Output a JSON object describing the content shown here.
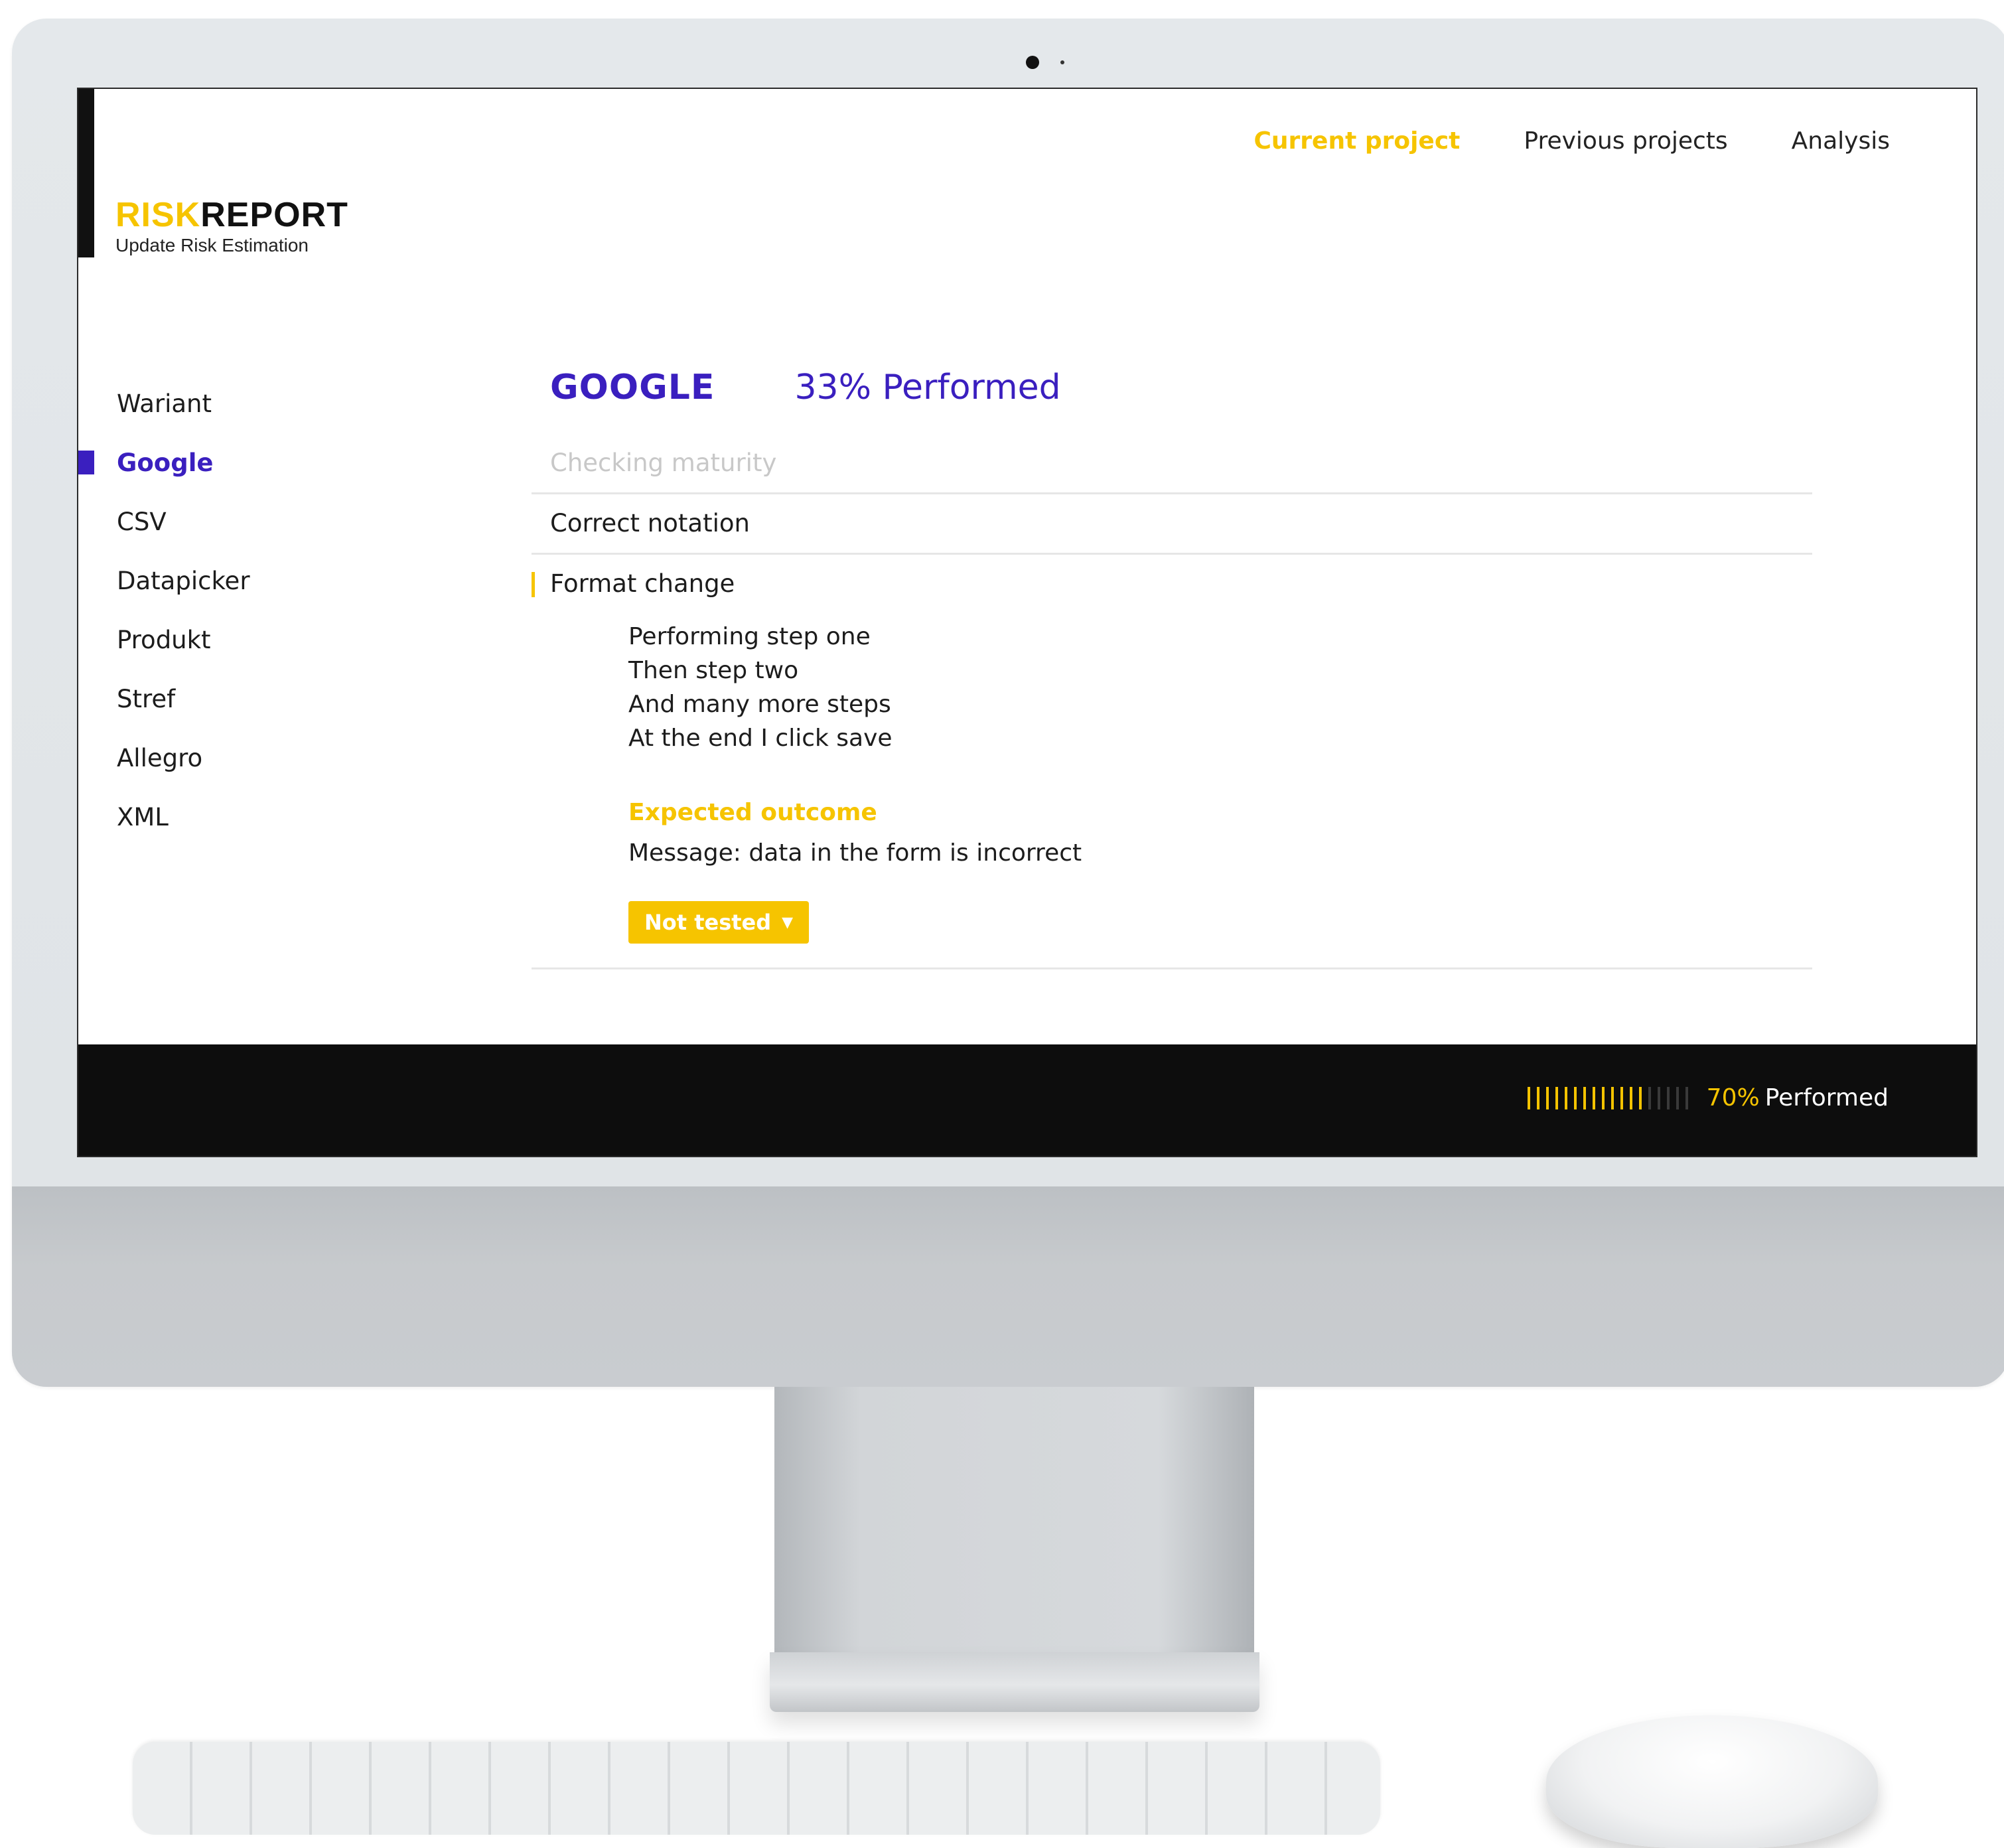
{
  "brand": {
    "risk": "RISK",
    "report": "REPORT",
    "subtitle": "Update Risk Estimation"
  },
  "topnav": [
    {
      "label": "Current project",
      "active": true
    },
    {
      "label": "Previous projects",
      "active": false
    },
    {
      "label": "Analysis",
      "active": false
    }
  ],
  "sidebar": {
    "items": [
      {
        "label": "Wariant"
      },
      {
        "label": "Google",
        "active": true
      },
      {
        "label": "CSV"
      },
      {
        "label": "Datapicker"
      },
      {
        "label": "Produkt"
      },
      {
        "label": "Stref"
      },
      {
        "label": "Allegro"
      },
      {
        "label": "XML"
      }
    ]
  },
  "main": {
    "title": "GOOGLE",
    "performed": "33% Performed",
    "rows": [
      {
        "label": "Checking maturity"
      },
      {
        "label": "Correct notation"
      },
      {
        "label": "Format change"
      }
    ],
    "steps": [
      "Performing step one",
      "Then step two",
      "And many more steps",
      "At the end I click save"
    ],
    "expected_title": "Expected outcome",
    "expected_text": "Message: data in the form is incorrect",
    "status": "Not tested"
  },
  "footer": {
    "progress_pct": "70%",
    "progress_label": "Performed",
    "progress_fraction": 0.7
  },
  "colors": {
    "accent_yellow": "#f6c400",
    "accent_purple": "#3a1fbf",
    "footer_bg": "#0d0d0d"
  }
}
